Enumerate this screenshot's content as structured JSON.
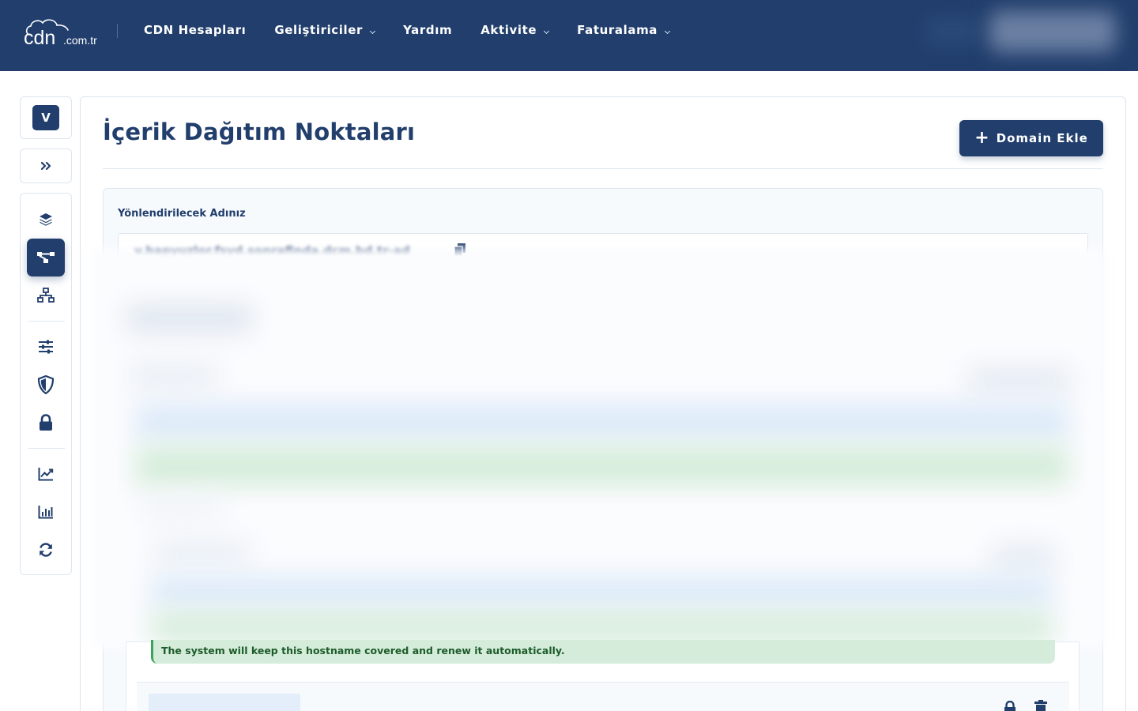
{
  "brand": {
    "logo_text": "cdn",
    "logo_suffix": ".com.tr"
  },
  "nav": {
    "items": [
      {
        "label": "CDN Hesapları",
        "has_dropdown": false
      },
      {
        "label": "Geliştiriciler",
        "has_dropdown": true
      },
      {
        "label": "Yardım",
        "has_dropdown": false
      },
      {
        "label": "Aktivite",
        "has_dropdown": true
      },
      {
        "label": "Faturalama",
        "has_dropdown": true
      }
    ]
  },
  "sidebar": {
    "avatar_letter": "V",
    "expand_icon": "double-chevron-right-icon",
    "items": [
      {
        "icon": "layers-icon",
        "active": false
      },
      {
        "icon": "distribution-nodes-icon",
        "active": true
      },
      {
        "icon": "network-tree-icon",
        "active": false
      },
      {
        "icon": "sliders-icon",
        "active": false
      },
      {
        "icon": "shield-icon",
        "active": false
      },
      {
        "icon": "lock-icon",
        "active": false
      },
      {
        "icon": "line-chart-icon",
        "active": false
      },
      {
        "icon": "bar-chart-icon",
        "active": false
      },
      {
        "icon": "refresh-icon",
        "active": false
      }
    ]
  },
  "page": {
    "title": "İçerik Dağıtım Noktaları",
    "add_button_label": "Domain Ekle"
  },
  "redirect": {
    "label": "Yönlendirilecek Adınız",
    "value": "v.bapyuzlor.fsyd.sonrafinda.dcm.bd.tr-ad"
  },
  "certificate": {
    "note": "The system will keep this hostname covered and renew it automatically."
  },
  "colors": {
    "brand_navy": "#213e6c",
    "success_bg": "#d4ecd9",
    "success_text": "#1c5b2a",
    "success_border": "#3aa55a",
    "info_blue": "#dbe9f8"
  }
}
